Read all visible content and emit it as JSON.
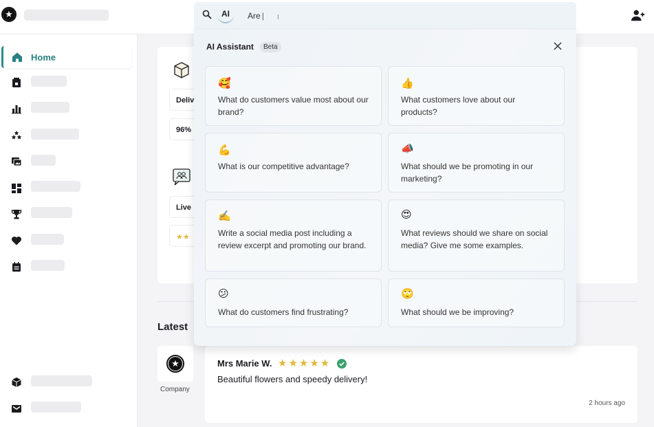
{
  "app": {
    "logo_glyph": "★"
  },
  "sidebar": {
    "home_label": "Home",
    "accent": "#2e8a8c",
    "icons": [
      "store-icon",
      "bar-chart-icon",
      "stars-icon",
      "images-icon",
      "dashboard-icon",
      "trophy-icon",
      "heart-icon",
      "calendar-icon",
      "box-icon",
      "inbox-icon"
    ]
  },
  "search": {
    "ai_chip": "AI",
    "query": "Are",
    "cursor": "I"
  },
  "assistant": {
    "title": "AI Assistant",
    "badge": "Beta",
    "suggestions": [
      {
        "emoji": "🥰",
        "text": "What do customers value most about our brand?"
      },
      {
        "emoji": "👍",
        "text": "What customers love about our products?"
      },
      {
        "emoji": "💪",
        "text": "What is our competitive advantage?"
      },
      {
        "emoji": "📣",
        "text": "What should we be promoting in our marketing?"
      },
      {
        "emoji": "✍️",
        "text": "Write a social media post including a review excerpt and promoting our brand."
      },
      {
        "emoji": "😍",
        "text": "What reviews should we share on social media? Give me some examples."
      },
      {
        "emoji": "😕",
        "text": "What do customers find frustrating?"
      },
      {
        "emoji": "🙄",
        "text": "What should we be improving?"
      }
    ]
  },
  "main": {
    "cards": {
      "delivery_label": "Deliv",
      "percent": "96%",
      "live_label": "Live",
      "stars": "★★"
    },
    "latest_title": "Latest",
    "company_label": "Company",
    "review": {
      "name": "Mrs Marie W.",
      "stars": "★★★★★",
      "text": "Beautiful flowers and speedy delivery!",
      "time": "2 hours ago"
    }
  }
}
